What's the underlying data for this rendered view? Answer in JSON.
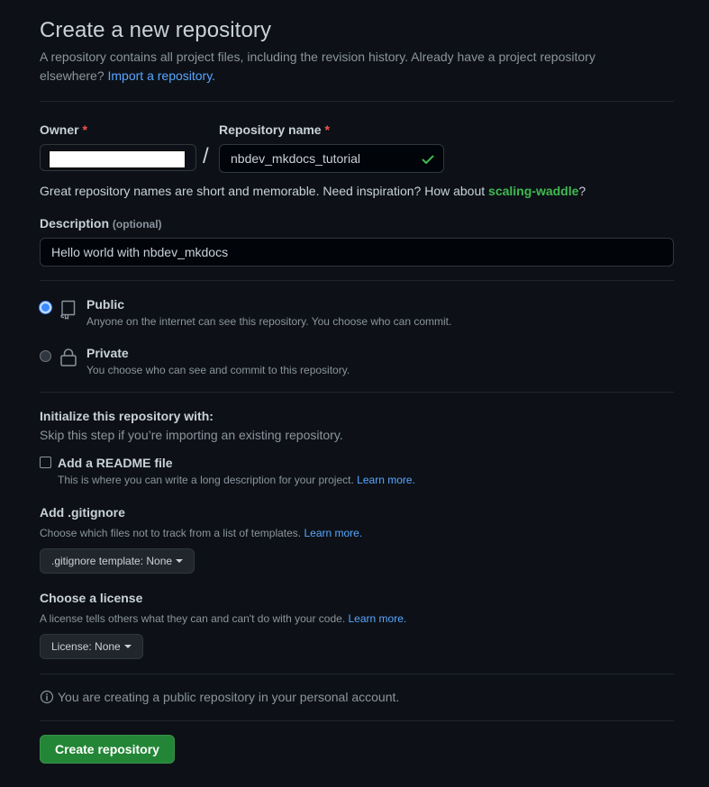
{
  "header": {
    "title": "Create a new repository",
    "subtitle": "A repository contains all project files, including the revision history. Already have a project repository elsewhere?",
    "import_link": "Import a repository."
  },
  "owner": {
    "label": "Owner",
    "required_mark": "*"
  },
  "separator": "/",
  "repo_name": {
    "label": "Repository name",
    "required_mark": "*",
    "value": "nbdev_mkdocs_tutorial"
  },
  "name_hint": {
    "text": "Great repository names are short and memorable. Need inspiration? How about",
    "suggestion": "scaling-waddle",
    "suffix": "?"
  },
  "description": {
    "label": "Description",
    "optional": "(optional)",
    "value": "Hello world with nbdev_mkdocs"
  },
  "visibility": {
    "public": {
      "title": "Public",
      "desc": "Anyone on the internet can see this repository. You choose who can commit.",
      "icon": "repo-icon",
      "selected": true
    },
    "private": {
      "title": "Private",
      "desc": "You choose who can see and commit to this repository.",
      "icon": "lock-icon",
      "selected": false
    }
  },
  "initialize": {
    "title": "Initialize this repository with:",
    "subtitle": "Skip this step if you’re importing an existing repository.",
    "readme": {
      "label": "Add a README file",
      "desc": "This is where you can write a long description for your project.",
      "link": "Learn more.",
      "checked": false
    }
  },
  "gitignore": {
    "title": "Add .gitignore",
    "desc": "Choose which files not to track from a list of templates.",
    "link": "Learn more.",
    "button": ".gitignore template: None"
  },
  "license": {
    "title": "Choose a license",
    "desc": "A license tells others what they can and can't do with your code.",
    "link": "Learn more.",
    "button": "License: None"
  },
  "info": {
    "icon": "info-icon",
    "text": "You are creating a public repository in your personal account."
  },
  "submit": {
    "label": "Create repository"
  },
  "colors": {
    "background": "#0d1117",
    "link": "#58a6ff",
    "accent_green": "#3fb950",
    "button_green": "#238636",
    "required": "#f85149"
  }
}
